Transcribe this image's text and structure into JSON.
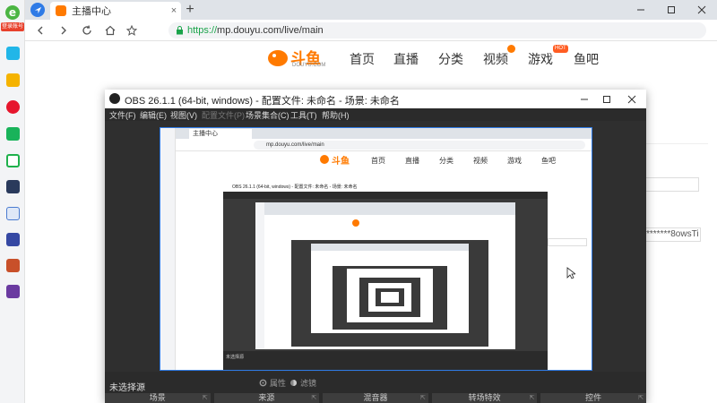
{
  "browser": {
    "tab_title": "主播中心",
    "tab_close": "×",
    "new_tab": "+",
    "url_scheme": "https://",
    "url_rest": "mp.douyu.com/live/main"
  },
  "sidebar": {
    "login_label": "登录账号"
  },
  "douyu": {
    "logo_text": "斗鱼",
    "logo_sub": "DOUYU.COM",
    "nav": [
      "首页",
      "直播",
      "分类",
      "视频",
      "游戏",
      "鱼吧"
    ],
    "game_badge": "HOT",
    "right_field_value": "*******8owsTi"
  },
  "obs": {
    "title": "OBS 26.1.1 (64-bit, windows) - 配置文件: 未命名 - 场景: 未命名",
    "menu": [
      "文件(F)",
      "编辑(E)",
      "视图(V)",
      "配置文件(P)",
      "场景集合(C)",
      "工具(T)",
      "帮助(H)"
    ],
    "no_source": "未选择源",
    "properties_label": "属性",
    "filters_label": "滤镜",
    "docks": [
      "场景",
      "来源",
      "混音器",
      "转场特效",
      "控件"
    ],
    "nested_title": "OBS 26.1.1 (64-bit, windows) - 配置文件: 未命名 - 场景: 未命名"
  },
  "colors": {
    "accent_blue": "#2f7be6",
    "douyu_orange": "#ff7a00",
    "obs_dark": "#3a3a3a"
  }
}
